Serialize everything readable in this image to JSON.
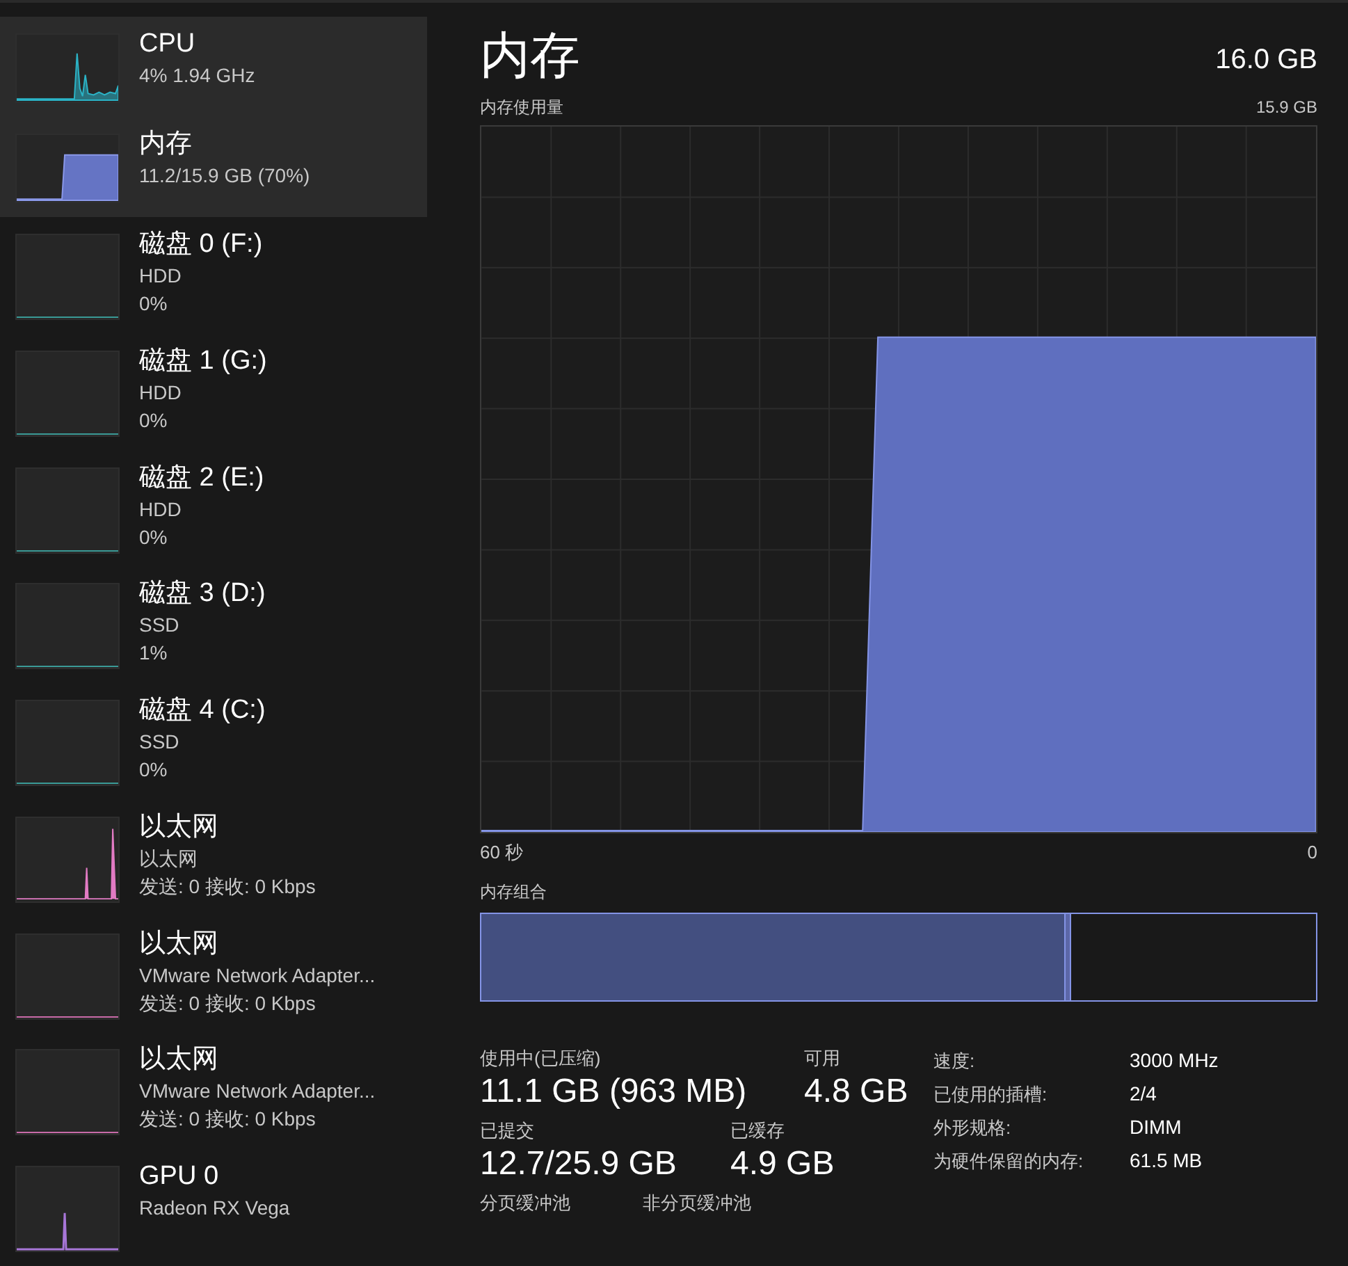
{
  "sidebar": {
    "items": [
      {
        "title": "CPU",
        "lines": [
          "4% 1.94 GHz"
        ],
        "kind": "cpu",
        "selected": true
      },
      {
        "title": "内存",
        "lines": [
          "11.2/15.9 GB (70%)"
        ],
        "kind": "memory",
        "selected": true
      },
      {
        "title": "磁盘 0 (F:)",
        "lines": [
          "HDD",
          "0%"
        ],
        "kind": "disk",
        "selected": false
      },
      {
        "title": "磁盘 1 (G:)",
        "lines": [
          "HDD",
          "0%"
        ],
        "kind": "disk",
        "selected": false
      },
      {
        "title": "磁盘 2 (E:)",
        "lines": [
          "HDD",
          "0%"
        ],
        "kind": "disk",
        "selected": false
      },
      {
        "title": "磁盘 3 (D:)",
        "lines": [
          "SSD",
          "1%"
        ],
        "kind": "disk",
        "selected": false
      },
      {
        "title": "磁盘 4 (C:)",
        "lines": [
          "SSD",
          "0%"
        ],
        "kind": "disk",
        "selected": false
      },
      {
        "title": "以太网",
        "lines": [
          "以太网",
          "发送: 0 接收: 0 Kbps"
        ],
        "kind": "ethernet",
        "selected": false
      },
      {
        "title": "以太网",
        "lines": [
          "VMware Network Adapter...",
          "发送: 0 接收: 0 Kbps"
        ],
        "kind": "adapter",
        "selected": false
      },
      {
        "title": "以太网",
        "lines": [
          "VMware Network Adapter...",
          "发送: 0 接收: 0 Kbps"
        ],
        "kind": "adapter",
        "selected": false
      },
      {
        "title": "GPU 0",
        "lines": [
          "Radeon RX Vega"
        ],
        "kind": "gpu",
        "selected": false
      }
    ]
  },
  "main": {
    "title": "内存",
    "capacity": "16.0 GB",
    "usage_chart": {
      "label": "内存使用量",
      "max_label": "15.9 GB",
      "x_start": "60 秒",
      "x_end": "0"
    },
    "composition": {
      "label": "内存组合"
    },
    "stats": [
      [
        {
          "label": "使用中(已压缩)",
          "value": "11.1 GB (963 MB)"
        },
        {
          "label": "可用",
          "value": "4.8 GB"
        }
      ],
      [
        {
          "label": "已提交",
          "value": "12.7/25.9 GB"
        },
        {
          "label": "已缓存",
          "value": "4.9 GB"
        }
      ],
      [
        {
          "label": "分页缓冲池"
        },
        {
          "label": "非分页缓冲池"
        }
      ]
    ],
    "details": [
      {
        "label": "速度:",
        "value": "3000 MHz"
      },
      {
        "label": "已使用的插槽:",
        "value": "2/4"
      },
      {
        "label": "外形规格:",
        "value": "DIMM"
      },
      {
        "label": "为硬件保留的内存:",
        "value": "61.5 MB"
      }
    ]
  }
}
